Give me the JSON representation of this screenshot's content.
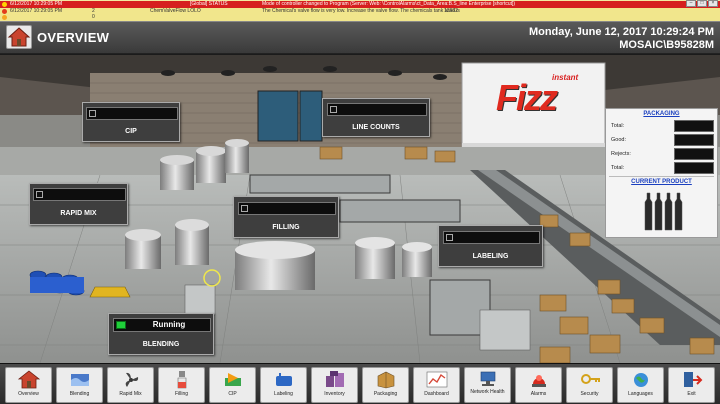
{
  "alarms": [
    {
      "date": "6/12/2017 10:29:05 PM",
      "count": "",
      "source": "[Global] STATUS",
      "message": "Mode of controller changed to Program (Server: Web: \\ControlAlarms\\ct_Data_Area:B.S_line Enterprise [shortcut])",
      "color": "#ffd400"
    },
    {
      "date": "6/12/2017 10:29:05 PM",
      "count": "2",
      "source": "ChemValveFlow LOLO",
      "message": "The Chemical's valve flow is very low. Increase the valve flow. The chemicals tank level is",
      "extra": "13982",
      "color": "#e23b1c"
    },
    {
      "date": "",
      "count": "0",
      "source": "",
      "message": "",
      "color": "#f5a623"
    }
  ],
  "header": {
    "title": "OVERVIEW",
    "datetime": "Monday, June 12, 2017   10:29:24 PM",
    "station": "MOSAIC\\B95828M"
  },
  "scene": {
    "brand_logo": "Fizz",
    "brand_logo_small": "instant"
  },
  "panels": {
    "cip": "CIP",
    "line_counts": "LINE COUNTS",
    "rapid_mix": "RAPID MIX",
    "filling": "FILLING",
    "labeling": "LABELING",
    "blending": "BLENDING",
    "blending_status": "Running"
  },
  "packaging": {
    "title": "PACKAGING",
    "total_label": "Total:",
    "good_label": "Good:",
    "rejects_label": "Rejects:",
    "total2_label": "Total:",
    "current_product_title": "CURRENT PRODUCT"
  },
  "nav": [
    {
      "label": "Overview",
      "icon": "home-icon"
    },
    {
      "label": "Blending",
      "icon": "blending-icon"
    },
    {
      "label": "Rapid Mix",
      "icon": "fan-icon"
    },
    {
      "label": "Filling",
      "icon": "filling-icon"
    },
    {
      "label": "CIP",
      "icon": "cip-icon"
    },
    {
      "label": "Labeling",
      "icon": "labeling-icon"
    },
    {
      "label": "Inventory",
      "icon": "inventory-icon"
    },
    {
      "label": "Packaging",
      "icon": "packaging-icon"
    },
    {
      "label": "Dashboard",
      "icon": "dashboard-icon"
    },
    {
      "label": "Network Health",
      "icon": "network-icon"
    },
    {
      "label": "Alarms",
      "icon": "alarm-icon"
    },
    {
      "label": "Security",
      "icon": "key-icon"
    },
    {
      "label": "Languages",
      "icon": "globe-icon"
    },
    {
      "label": "Exit",
      "icon": "exit-icon"
    }
  ],
  "colors": {
    "panel_bg": "#3e3e3e",
    "running_green": "#1fcf3a",
    "title_blue": "#1a3fbf",
    "alarm_red": "#d61f1f"
  }
}
